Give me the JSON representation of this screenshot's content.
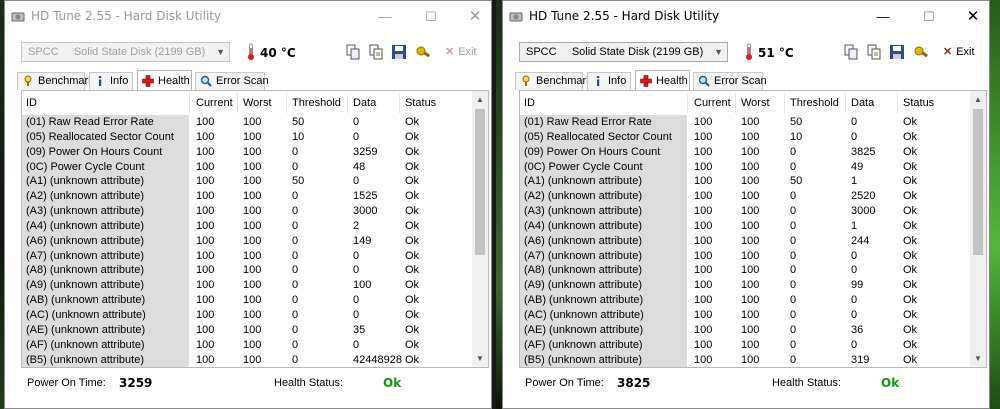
{
  "windows": [
    {
      "id": "left",
      "state": "inactive",
      "title": "HD Tune 2.55 - Hard Disk Utility",
      "title_buttons": {
        "minimize": "—",
        "maximize": "☐",
        "close": "✕"
      },
      "drive_select": {
        "value": "SPCC     Solid State Disk (2199 GB)"
      },
      "temperature": "40 °C",
      "exit_label": "Exit",
      "tabs": [
        {
          "label": "Benchmark",
          "icon": "benchmark-icon",
          "active": false
        },
        {
          "label": "Info",
          "icon": "info-icon",
          "active": false
        },
        {
          "label": "Health",
          "icon": "health-cross-icon",
          "active": true
        },
        {
          "label": "Error Scan",
          "icon": "error-scan-icon",
          "active": false
        }
      ],
      "table": {
        "columns": [
          "ID",
          "Current",
          "Worst",
          "Threshold",
          "Data",
          "Status"
        ],
        "rows": [
          [
            "(01) Raw Read Error Rate",
            "100",
            "100",
            "50",
            "0",
            "Ok"
          ],
          [
            "(05) Reallocated Sector Count",
            "100",
            "100",
            "10",
            "0",
            "Ok"
          ],
          [
            "(09) Power On Hours Count",
            "100",
            "100",
            "0",
            "3259",
            "Ok"
          ],
          [
            "(0C) Power Cycle Count",
            "100",
            "100",
            "0",
            "48",
            "Ok"
          ],
          [
            "(A1) (unknown attribute)",
            "100",
            "100",
            "50",
            "0",
            "Ok"
          ],
          [
            "(A2) (unknown attribute)",
            "100",
            "100",
            "0",
            "1525",
            "Ok"
          ],
          [
            "(A3) (unknown attribute)",
            "100",
            "100",
            "0",
            "3000",
            "Ok"
          ],
          [
            "(A4) (unknown attribute)",
            "100",
            "100",
            "0",
            "2",
            "Ok"
          ],
          [
            "(A6) (unknown attribute)",
            "100",
            "100",
            "0",
            "149",
            "Ok"
          ],
          [
            "(A7) (unknown attribute)",
            "100",
            "100",
            "0",
            "0",
            "Ok"
          ],
          [
            "(A8) (unknown attribute)",
            "100",
            "100",
            "0",
            "0",
            "Ok"
          ],
          [
            "(A9) (unknown attribute)",
            "100",
            "100",
            "0",
            "100",
            "Ok"
          ],
          [
            "(AB) (unknown attribute)",
            "100",
            "100",
            "0",
            "0",
            "Ok"
          ],
          [
            "(AC) (unknown attribute)",
            "100",
            "100",
            "0",
            "0",
            "Ok"
          ],
          [
            "(AE) (unknown attribute)",
            "100",
            "100",
            "0",
            "35",
            "Ok"
          ],
          [
            "(AF) (unknown attribute)",
            "100",
            "100",
            "0",
            "0",
            "Ok"
          ],
          [
            "(B5) (unknown attribute)",
            "100",
            "100",
            "0",
            "42448928",
            "Ok"
          ]
        ]
      },
      "status": {
        "power_on_label": "Power On Time:",
        "power_on_value": "3259",
        "health_label": "Health Status:",
        "health_value": "Ok"
      }
    },
    {
      "id": "right",
      "state": "active",
      "title": "HD Tune 2.55 - Hard Disk Utility",
      "title_buttons": {
        "minimize": "—",
        "maximize": "☐",
        "close": "✕"
      },
      "drive_select": {
        "value": "SPCC     Solid State Disk (2199 GB)"
      },
      "temperature": "51 °C",
      "exit_label": "Exit",
      "tabs": [
        {
          "label": "Benchmark",
          "icon": "benchmark-icon",
          "active": false
        },
        {
          "label": "Info",
          "icon": "info-icon",
          "active": false
        },
        {
          "label": "Health",
          "icon": "health-cross-icon",
          "active": true
        },
        {
          "label": "Error Scan",
          "icon": "error-scan-icon",
          "active": false
        }
      ],
      "table": {
        "columns": [
          "ID",
          "Current",
          "Worst",
          "Threshold",
          "Data",
          "Status"
        ],
        "rows": [
          [
            "(01) Raw Read Error Rate",
            "100",
            "100",
            "50",
            "0",
            "Ok"
          ],
          [
            "(05) Reallocated Sector Count",
            "100",
            "100",
            "10",
            "0",
            "Ok"
          ],
          [
            "(09) Power On Hours Count",
            "100",
            "100",
            "0",
            "3825",
            "Ok"
          ],
          [
            "(0C) Power Cycle Count",
            "100",
            "100",
            "0",
            "49",
            "Ok"
          ],
          [
            "(A1) (unknown attribute)",
            "100",
            "100",
            "50",
            "1",
            "Ok"
          ],
          [
            "(A2) (unknown attribute)",
            "100",
            "100",
            "0",
            "2520",
            "Ok"
          ],
          [
            "(A3) (unknown attribute)",
            "100",
            "100",
            "0",
            "3000",
            "Ok"
          ],
          [
            "(A4) (unknown attribute)",
            "100",
            "100",
            "0",
            "1",
            "Ok"
          ],
          [
            "(A6) (unknown attribute)",
            "100",
            "100",
            "0",
            "244",
            "Ok"
          ],
          [
            "(A7) (unknown attribute)",
            "100",
            "100",
            "0",
            "0",
            "Ok"
          ],
          [
            "(A8) (unknown attribute)",
            "100",
            "100",
            "0",
            "0",
            "Ok"
          ],
          [
            "(A9) (unknown attribute)",
            "100",
            "100",
            "0",
            "99",
            "Ok"
          ],
          [
            "(AB) (unknown attribute)",
            "100",
            "100",
            "0",
            "0",
            "Ok"
          ],
          [
            "(AC) (unknown attribute)",
            "100",
            "100",
            "0",
            "0",
            "Ok"
          ],
          [
            "(AE) (unknown attribute)",
            "100",
            "100",
            "0",
            "36",
            "Ok"
          ],
          [
            "(AF) (unknown attribute)",
            "100",
            "100",
            "0",
            "0",
            "Ok"
          ],
          [
            "(B5) (unknown attribute)",
            "100",
            "100",
            "0",
            "319",
            "Ok"
          ]
        ]
      },
      "status": {
        "power_on_label": "Power On Time:",
        "power_on_value": "3825",
        "health_label": "Health Status:",
        "health_value": "Ok"
      }
    }
  ],
  "colors": {
    "health_ok": "#0a9c0a",
    "id_column_bg": "#dcdcdc",
    "desktop_green": "#52b73a"
  }
}
